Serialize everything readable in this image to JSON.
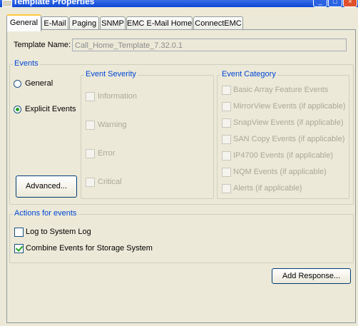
{
  "window": {
    "title": "Template Properties"
  },
  "tabs": [
    {
      "label": "General"
    },
    {
      "label": "E-Mail"
    },
    {
      "label": "Paging"
    },
    {
      "label": "SNMP"
    },
    {
      "label": "EMC E-Mail Home"
    },
    {
      "label": "ConnectEMC"
    }
  ],
  "template_name": {
    "label": "Template Name:",
    "value": "Call_Home_Template_7.32.0.1"
  },
  "events": {
    "legend": "Events",
    "radio_general": "General",
    "radio_explicit": "Explicit Events",
    "selected": "Explicit Events",
    "advanced_button": "Advanced..."
  },
  "severity": {
    "legend": "Event Severity",
    "items": [
      "Information",
      "Warning",
      "Error",
      "Critical"
    ]
  },
  "category": {
    "legend": "Event Category",
    "items": [
      "Basic Array Feature Events",
      "MirrorView Events (if applicable)",
      "SnapView Events (if applicable)",
      "SAN Copy Events (if applicable)",
      "IP4700 Events (if applicable)",
      "NQM Events (if applicable)",
      "Alerts (if applicable)"
    ]
  },
  "actions": {
    "legend": "Actions for events",
    "log_label": "Log to System Log",
    "log_checked": false,
    "combine_label": "Combine Events for Storage System",
    "combine_checked": true
  },
  "add_response_button": "Add Response..."
}
